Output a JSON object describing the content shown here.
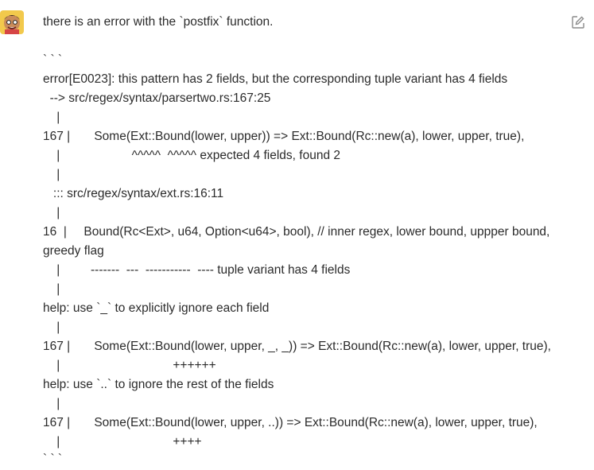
{
  "message": {
    "title": "there is an error with the `postfix` function.",
    "lines": [
      "` ` `",
      "error[E0023]: this pattern has 2 fields, but the corresponding tuple variant has 4 fields",
      "  --> src/regex/syntax/parsertwo.rs:167:25",
      "    |",
      "167 |       Some(Ext::Bound(lower, upper)) => Ext::Bound(Rc::new(a), lower, upper, true),",
      "    |                     ^^^^^  ^^^^^ expected 4 fields, found 2",
      "    |",
      "   ::: src/regex/syntax/ext.rs:16:11",
      "    |",
      "16  |     Bound(Rc<Ext>, u64, Option<u64>, bool), // inner regex, lower bound, uppper bound,",
      "greedy flag",
      "    |         -------  ---  -----------  ---- tuple variant has 4 fields",
      "    |",
      "help: use `_` to explicitly ignore each field",
      "    |",
      "167 |       Some(Ext::Bound(lower, upper, _, _)) => Ext::Bound(Rc::new(a), lower, upper, true),",
      "    |                                 ++++++",
      "help: use `..` to ignore the rest of the fields",
      "    |",
      "167 |       Some(Ext::Bound(lower, upper, ..)) => Ext::Bound(Rc::new(a), lower, upper, true),",
      "    |                                 ++++",
      "` ` `"
    ]
  },
  "icons": {
    "avatar": "user-avatar",
    "edit": "edit-icon"
  }
}
